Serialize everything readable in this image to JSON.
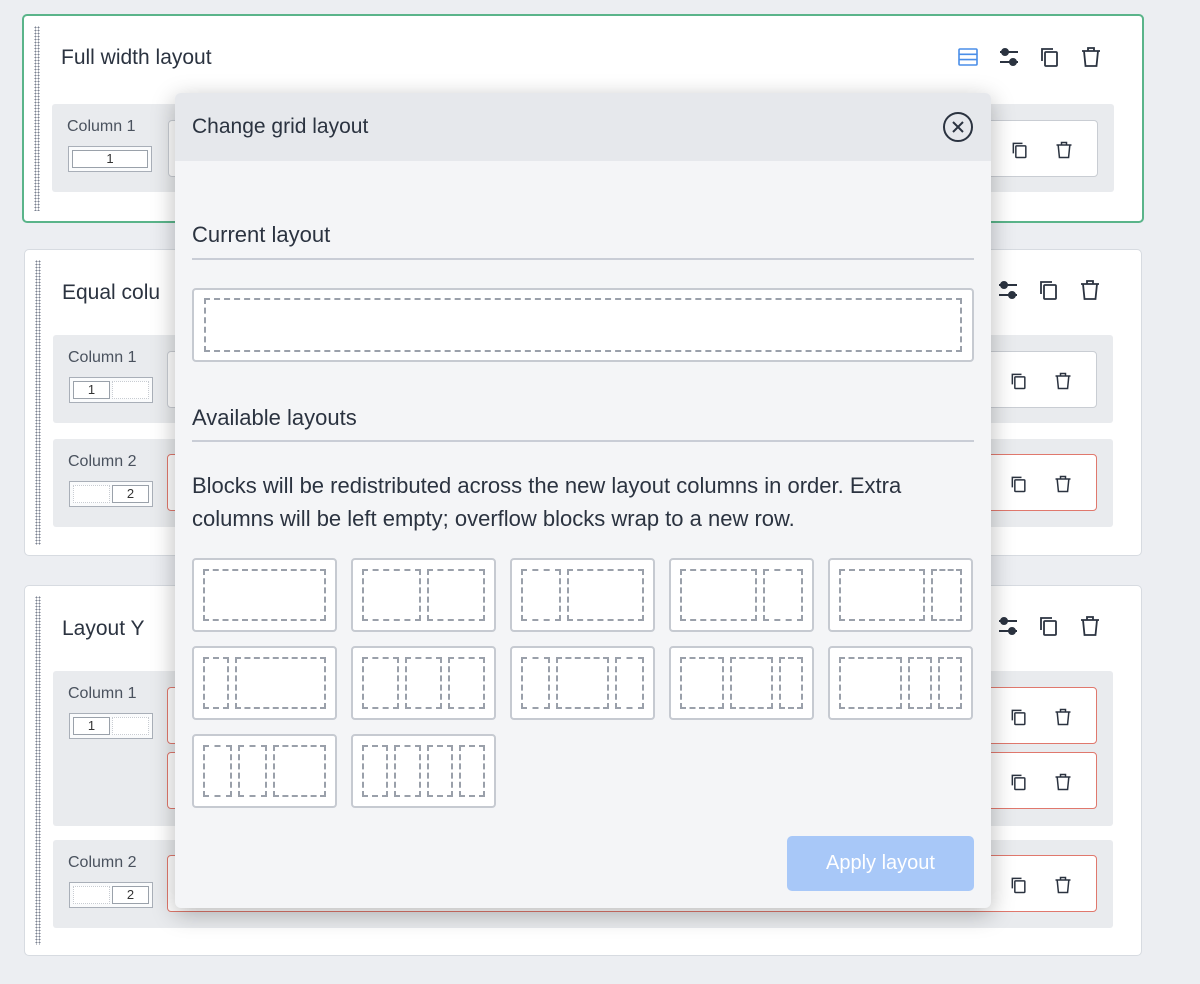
{
  "sections": [
    {
      "title": "Full width layout",
      "columns": [
        {
          "label": "Column 1",
          "cells": [
            "1"
          ]
        }
      ]
    },
    {
      "title": "Equal colu",
      "columns": [
        {
          "label": "Column 1",
          "cells": [
            "1",
            ""
          ]
        },
        {
          "label": "Column 2",
          "cells": [
            "",
            "2"
          ]
        }
      ]
    },
    {
      "title": "Layout Y",
      "columns": [
        {
          "label": "Column 1",
          "cells": [
            "1",
            ""
          ]
        },
        {
          "label": "Column 2",
          "cells": [
            "",
            "2"
          ]
        }
      ]
    }
  ],
  "modal": {
    "title": "Change grid layout",
    "current_heading": "Current layout",
    "available_heading": "Available layouts",
    "description": "Blocks will be redistributed across the new layout columns in order. Extra columns will be left empty; overflow blocks wrap to a new row.",
    "apply_label": "Apply layout",
    "layouts": [
      [
        1
      ],
      [
        1,
        1
      ],
      [
        1,
        2
      ],
      [
        2,
        1
      ],
      [
        3,
        1
      ],
      [
        1,
        4
      ],
      [
        1,
        1,
        1
      ],
      [
        1,
        2,
        1
      ],
      [
        2,
        2,
        1
      ],
      [
        3,
        1,
        1
      ],
      [
        1,
        1,
        2
      ],
      [
        1,
        1,
        1,
        1
      ]
    ]
  },
  "colors": {
    "accent": "#5ab48a",
    "error": "#e0786d",
    "primary_disabled": "#a8c8f8",
    "active_icon": "#4a8ee8"
  }
}
